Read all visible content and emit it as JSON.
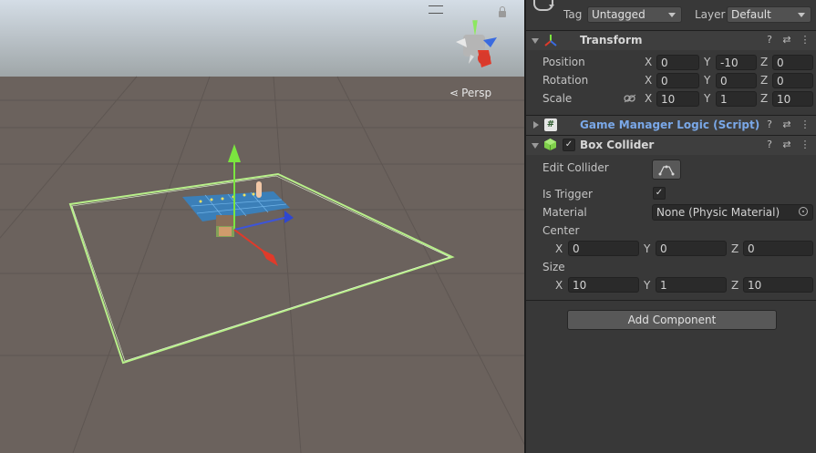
{
  "scene": {
    "projection_label": "Persp"
  },
  "inspector": {
    "tag_label": "Tag",
    "tag_value": "Untagged",
    "layer_label": "Layer",
    "layer_value": "Default",
    "transform": {
      "title": "Transform",
      "position_label": "Position",
      "rotation_label": "Rotation",
      "scale_label": "Scale",
      "axis_x": "X",
      "axis_y": "Y",
      "axis_z": "Z",
      "position": {
        "x": "0",
        "y": "-10",
        "z": "0"
      },
      "rotation": {
        "x": "0",
        "y": "0",
        "z": "0"
      },
      "scale": {
        "x": "10",
        "y": "1",
        "z": "10"
      }
    },
    "script_component": {
      "title": "Game Manager Logic (Script)",
      "icon": "#"
    },
    "box_collider": {
      "title": "Box Collider",
      "edit_collider_label": "Edit Collider",
      "is_trigger_label": "Is Trigger",
      "is_trigger_checked": "✓",
      "enabled_check": "✓",
      "material_label": "Material",
      "material_value": "None (Physic Material)",
      "center_label": "Center",
      "size_label": "Size",
      "center": {
        "x": "0",
        "y": "0",
        "z": "0"
      },
      "size": {
        "x": "10",
        "y": "1",
        "z": "10"
      }
    },
    "add_component_label": "Add Component"
  }
}
